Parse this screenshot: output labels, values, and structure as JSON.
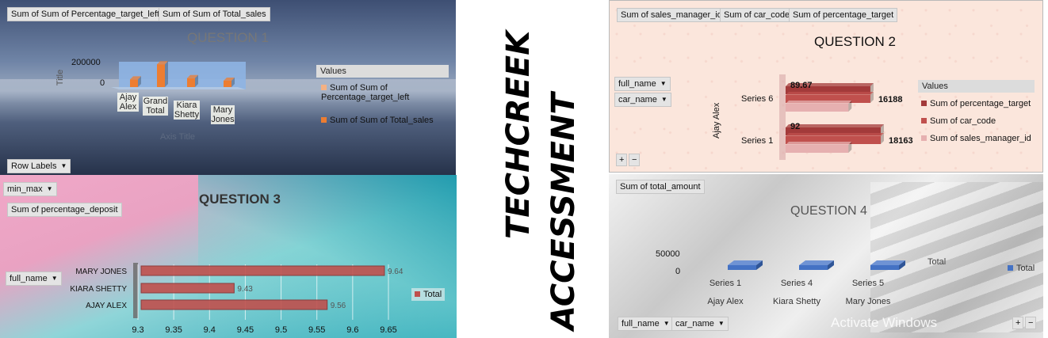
{
  "q1": {
    "title": "QUESTION 1",
    "field_buttons": [
      "Sum of Sum of Percentage_target_left",
      "Sum of Sum of Total_sales"
    ],
    "legend_header": "Values",
    "legend_items": [
      "Sum of Sum of Percentage_target_left",
      "Sum of Sum of Total_sales"
    ],
    "row_labels_button": "Row Labels",
    "axis_title": "Axis Title",
    "y_axis_title": "Title",
    "y_ticks": [
      "200000",
      "0"
    ],
    "categories": [
      "Ajay Alex",
      "Grand Total",
      "Kiara Shetty",
      "Mary Jones"
    ],
    "colors": {
      "series1": "#f4b183",
      "series2": "#ed7d31"
    }
  },
  "q2": {
    "title": "QUESTION 2",
    "field_buttons": [
      "Sum of sales_manager_id",
      "Sum of car_code",
      "Sum of percentage_target"
    ],
    "filters": [
      "full_name",
      "car_name"
    ],
    "legend_header": "Values",
    "legend_items": [
      "Sum of percentage_target",
      "Sum of car_code",
      "Sum of sales_manager_id"
    ],
    "group_label": "Ajay Alex",
    "series_labels": [
      "Series 6",
      "Series 1"
    ],
    "data_labels": [
      "89.67",
      "16188",
      "92",
      "18163"
    ],
    "expand_buttons": [
      "+",
      "−"
    ],
    "colors": {
      "percentage_target": "#a33a3a",
      "car_code": "#c0504d",
      "sales_manager_id": "#e6b0b0"
    }
  },
  "q3": {
    "title": "QUESTION 3",
    "filter_top": "min_max",
    "value_field": "Sum of percentage_deposit",
    "row_filter": "full_name",
    "legend_item": "Total",
    "color": "#c0504d"
  },
  "q4": {
    "title": "QUESTION 4",
    "value_field": "Sum of total_amount",
    "series_label": "Total",
    "legend_item": "Total",
    "y_ticks": [
      "50000",
      "0"
    ],
    "categories": [
      {
        "series": "Series 1",
        "name": "Ajay Alex"
      },
      {
        "series": "Series 4",
        "name": "Kiara Shetty"
      },
      {
        "series": "Series 5",
        "name": "Mary Jones"
      }
    ],
    "filters": [
      "full_name",
      "car_name"
    ],
    "expand_buttons": [
      "+",
      "−"
    ],
    "watermark": "Activate Windows",
    "color": "#4472c4"
  },
  "center": {
    "line1": "TECHCREEK",
    "line2": "ACCESSMENT"
  },
  "chart_data": [
    {
      "type": "bar",
      "title": "QUESTION 1",
      "categories": [
        "Ajay Alex",
        "Grand Total",
        "Kiara Shetty",
        "Mary Jones"
      ],
      "series": [
        {
          "name": "Sum of Sum of Percentage_target_left",
          "values": [
            0,
            0,
            0,
            0
          ]
        },
        {
          "name": "Sum of Sum of Total_sales",
          "values": [
            60000,
            180000,
            70000,
            50000
          ]
        }
      ],
      "xlabel": "Axis Title",
      "ylabel": "Title",
      "ylim": [
        0,
        200000
      ],
      "legend": "right"
    },
    {
      "type": "bar",
      "title": "QUESTION 2",
      "categories": [
        "Series 6",
        "Series 1"
      ],
      "series": [
        {
          "name": "Sum of percentage_target",
          "values": [
            89.67,
            92
          ]
        },
        {
          "name": "Sum of car_code",
          "values": [
            16188,
            18163
          ]
        },
        {
          "name": "Sum of sales_manager_id",
          "values": [
            12000,
            12000
          ]
        }
      ],
      "legend": "right"
    },
    {
      "type": "bar",
      "title": "QUESTION 3",
      "categories": [
        "MARY JONES",
        "KIARA SHETTY",
        "AJAY ALEX"
      ],
      "series": [
        {
          "name": "Total",
          "values": [
            9.64,
            9.43,
            9.56
          ]
        }
      ],
      "xticks": [
        "9.3",
        "9.35",
        "9.4",
        "9.45",
        "9.5",
        "9.55",
        "9.6",
        "9.65"
      ],
      "xlim": [
        9.3,
        9.65
      ],
      "legend": "right"
    },
    {
      "type": "bar",
      "title": "QUESTION 4",
      "categories": [
        "Series 1",
        "Series 4",
        "Series 5"
      ],
      "series": [
        {
          "name": "Total",
          "values": [
            15000,
            15000,
            15000
          ]
        }
      ],
      "ylim": [
        0,
        50000
      ],
      "legend": "right"
    }
  ]
}
